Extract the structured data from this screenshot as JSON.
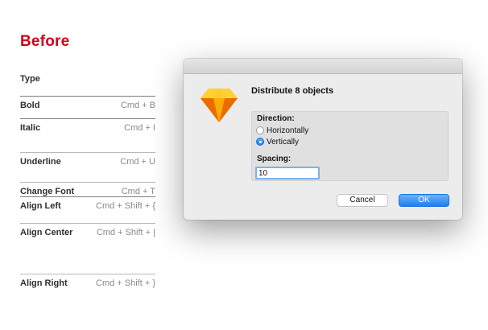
{
  "page": {
    "title": "Before",
    "type_heading": "Type"
  },
  "shortcuts": [
    {
      "name": "Bold",
      "keys": "Cmd + B"
    },
    {
      "name": "Italic",
      "keys": "Cmd + I"
    },
    {
      "name": "Underline",
      "keys": "Cmd + U"
    },
    {
      "name": "Change Font",
      "keys": "Cmd + T"
    },
    {
      "name": "Align Left",
      "keys": "Cmd + Shift + {"
    },
    {
      "name": "Align Center",
      "keys": "Cmd + Shift + |"
    },
    {
      "name": "Align Right",
      "keys": "Cmd + Shift + }"
    }
  ],
  "dialog": {
    "icon": "sketch-diamond-icon",
    "heading": "Distribute 8 objects",
    "direction_label": "Direction:",
    "options": [
      {
        "label": "Horizontally",
        "selected": false
      },
      {
        "label": "Vertically",
        "selected": true
      }
    ],
    "spacing_label": "Spacing:",
    "spacing_value": "10",
    "cancel_label": "Cancel",
    "ok_label": "OK"
  },
  "colors": {
    "title_red": "#d0021b",
    "accent_blue": "#1e7ef2",
    "icon_orange": "#f7a823"
  }
}
